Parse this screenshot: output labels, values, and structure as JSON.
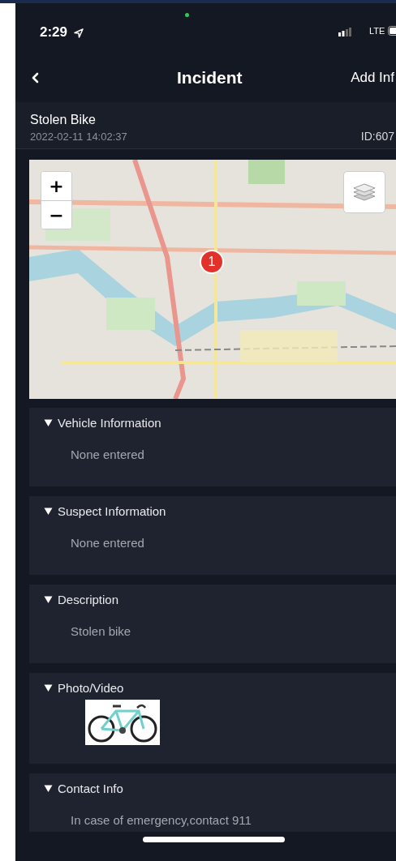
{
  "status_bar": {
    "time": "2:29",
    "network": "LTE"
  },
  "nav": {
    "title": "Incident",
    "action": "Add Inf"
  },
  "incident": {
    "title": "Stolen Bike",
    "timestamp": "2022-02-11 14:02:37",
    "id": "ID:607"
  },
  "map": {
    "zoom_in": "+",
    "zoom_out": "−",
    "markers": [
      {
        "label": "1"
      }
    ]
  },
  "sections": [
    {
      "kind": "text",
      "title": "Vehicle Information",
      "expanded": true,
      "text": "None entered"
    },
    {
      "kind": "text",
      "title": "Suspect Information",
      "expanded": true,
      "text": "None entered"
    },
    {
      "kind": "text",
      "title": "Description",
      "expanded": true,
      "text": "Stolen bike"
    },
    {
      "title": "Photo/Video",
      "expanded": true
    },
    {
      "kind": "text",
      "title": "Contact Info",
      "expanded": true,
      "text": "In case of emergency,contact 911"
    }
  ]
}
